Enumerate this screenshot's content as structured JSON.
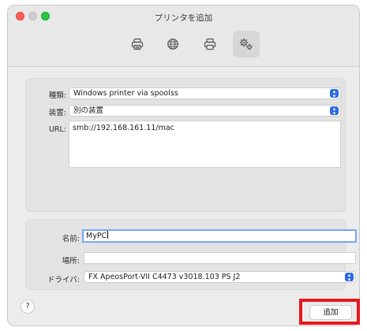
{
  "window": {
    "title": "プリンタを追加"
  },
  "toolbar": {
    "items": [
      {
        "name": "default-printers",
        "icon": "printer-icon",
        "active": false
      },
      {
        "name": "ip-printers",
        "icon": "globe-icon",
        "active": false
      },
      {
        "name": "windows-printers",
        "icon": "printer-icon",
        "active": false
      },
      {
        "name": "advanced",
        "icon": "gears-icon",
        "active": true
      }
    ]
  },
  "form": {
    "type_label": "種類:",
    "type_value": "Windows printer via spoolss",
    "device_label": "装置:",
    "device_value": "別の装置",
    "url_label": "URL:",
    "url_value": "smb://192.168.161.11/mac",
    "name_label": "名前:",
    "name_value": "MyPC",
    "location_label": "場所:",
    "location_value": "",
    "driver_label": "ドライバ:",
    "driver_value": "FX ApeosPort-VII C4473 v3018.103 PS J2"
  },
  "buttons": {
    "help_label": "?",
    "add_label": "追加"
  },
  "colors": {
    "accent": "#2c6be4",
    "focus_ring": "#74a7ef",
    "highlight": "#e8171c",
    "close": "#fe5f57",
    "zoom": "#28c840"
  }
}
